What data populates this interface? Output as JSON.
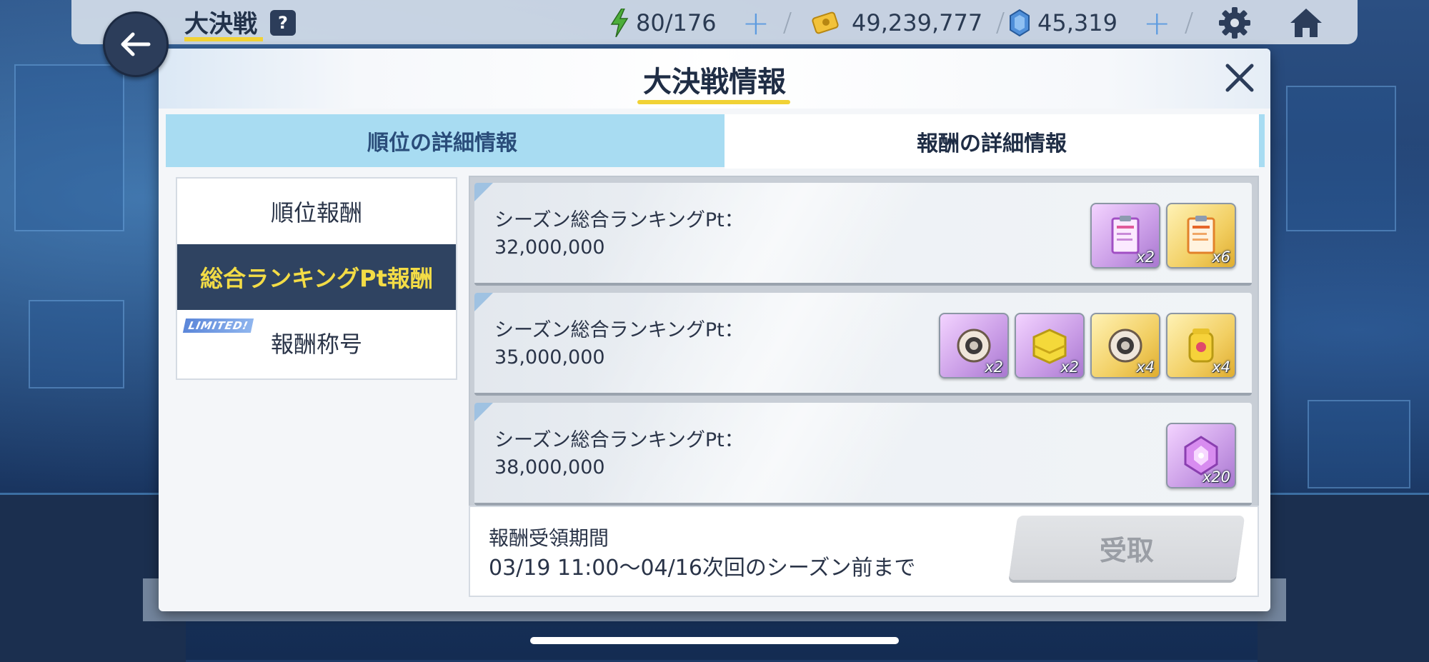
{
  "topbar": {
    "title": "大決戦",
    "help": "?",
    "stamina": "80/176",
    "credits": "49,239,777",
    "gems": "45,319"
  },
  "modal": {
    "title": "大決戦情報",
    "tabs": [
      {
        "label": "順位の詳細情報",
        "selected": false
      },
      {
        "label": "報酬の詳細情報",
        "selected": true
      }
    ],
    "menu": [
      {
        "label": "順位報酬",
        "selected": false
      },
      {
        "label": "総合ランキングPt報酬",
        "selected": true
      },
      {
        "label": "報酬称号",
        "selected": false,
        "badge": "LIMITED!"
      }
    ],
    "rewards": [
      {
        "label": "シーズン総合ランキングPt：",
        "points": "32,000,000",
        "items": [
          {
            "icon": "report-purple-icon",
            "qty": "x2"
          },
          {
            "icon": "report-orange-icon",
            "qty": "x6"
          }
        ]
      },
      {
        "label": "シーズン総合ランキングPt：",
        "points": "35,000,000",
        "items": [
          {
            "icon": "gear-part-purple-icon",
            "qty": "x2"
          },
          {
            "icon": "cloth-yellow-icon",
            "qty": "x2"
          },
          {
            "icon": "gear-part-gold-icon",
            "qty": "x4"
          },
          {
            "icon": "jar-gold-icon",
            "qty": "x4"
          }
        ]
      },
      {
        "label": "シーズン総合ランキングPt：",
        "points": "38,000,000",
        "items": [
          {
            "icon": "crystal-purple-icon",
            "qty": "x20"
          }
        ]
      }
    ],
    "footer": {
      "period_label": "報酬受領期間",
      "period_value": "03/19 11:00～04/16次回のシーズン前まで",
      "claim_label": "受取"
    }
  },
  "colors": {
    "accent_yellow": "#f1d235",
    "tab_blue": "#a8dcf2",
    "menu_active_bg": "#2f4361",
    "menu_active_text": "#f3dc46"
  }
}
